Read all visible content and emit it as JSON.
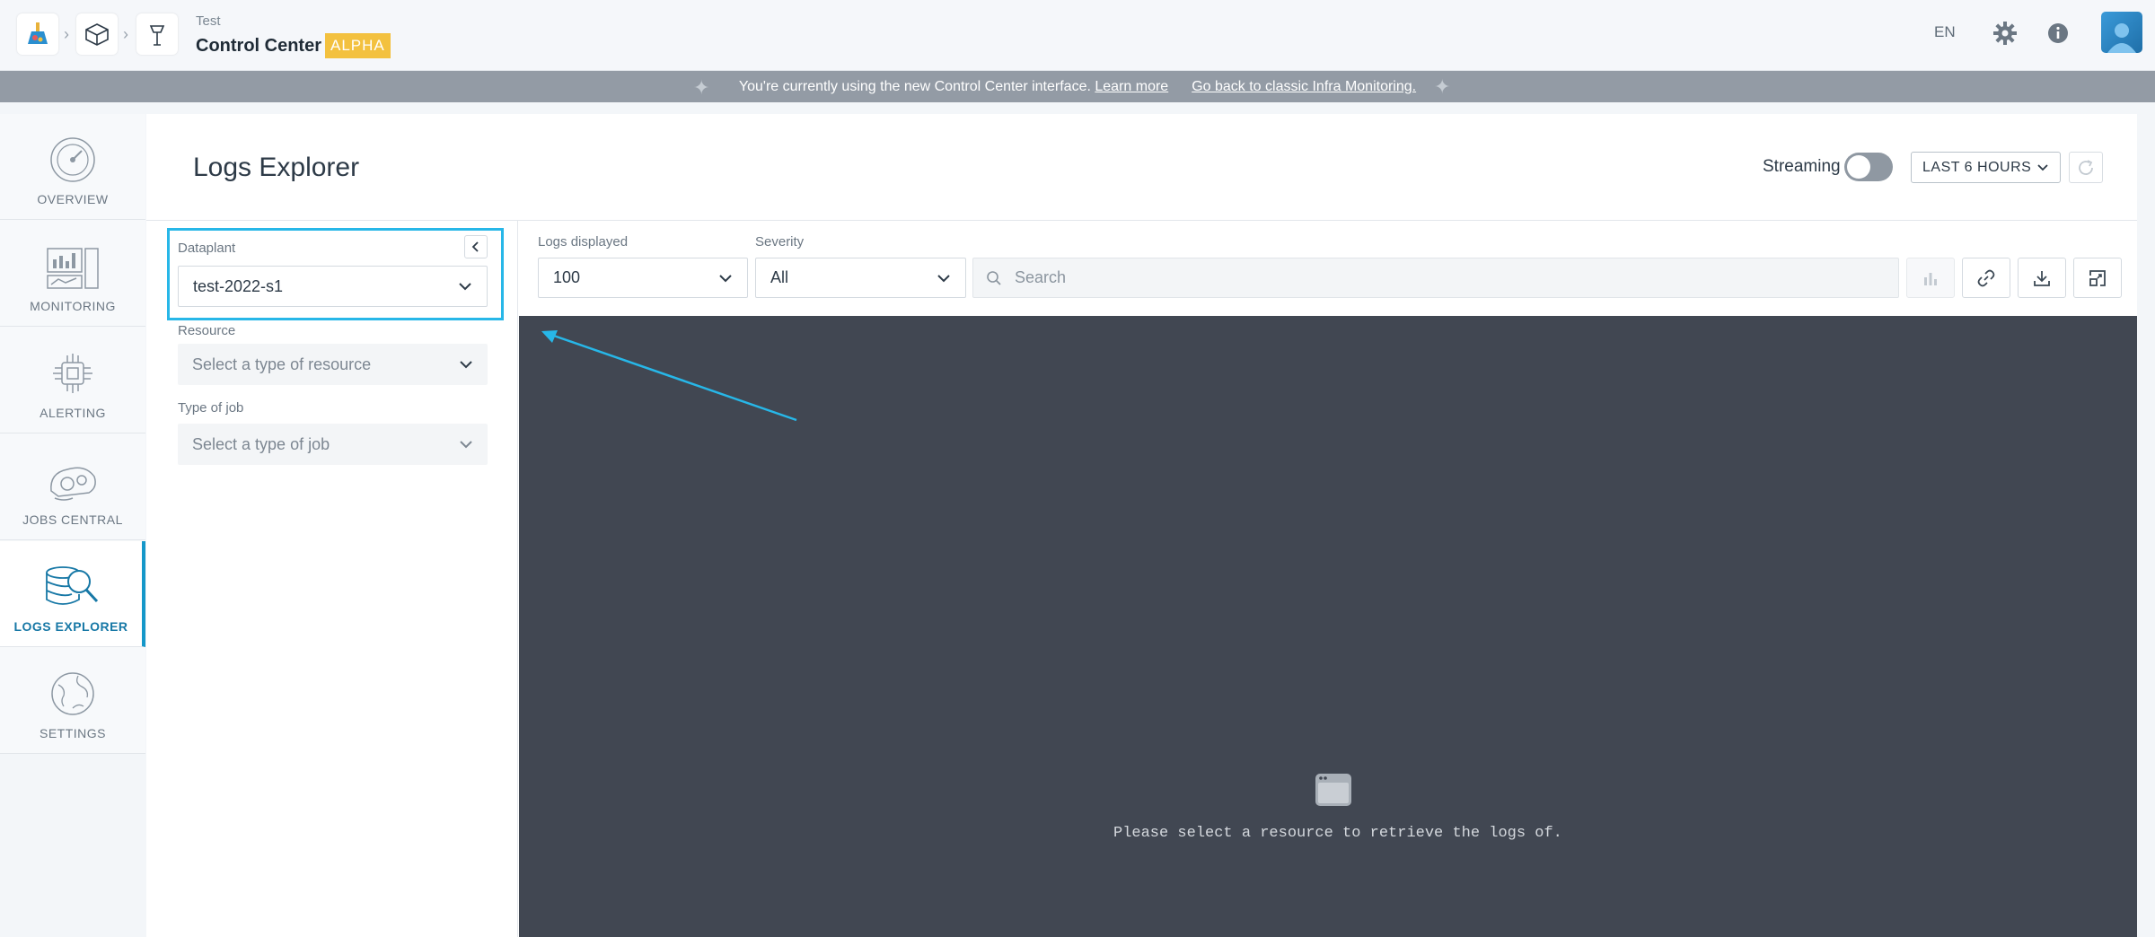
{
  "header": {
    "app_small": "Test",
    "app_title": "Control Center",
    "badge": "ALPHA",
    "language": "EN",
    "icons": [
      "logo-icon",
      "cube-icon",
      "lamp-icon",
      "gear-icon",
      "info-icon",
      "avatar"
    ]
  },
  "banner": {
    "text": "You're currently using the new Control Center interface.",
    "learn_more": "Learn more",
    "back_link": "Go back to classic Infra Monitoring."
  },
  "nav": {
    "items": [
      {
        "label": "OVERVIEW",
        "icon": "dashboard-gauge-icon"
      },
      {
        "label": "MONITORING",
        "icon": "monitoring-charts-icon"
      },
      {
        "label": "ALERTING",
        "icon": "alerting-chip-icon"
      },
      {
        "label": "JOBS CENTRAL",
        "icon": "jobs-brain-icon"
      },
      {
        "label": "LOGS EXPLORER",
        "icon": "logs-database-search-icon"
      },
      {
        "label": "SETTINGS",
        "icon": "settings-globe-icon"
      }
    ],
    "active": "LOGS EXPLORER"
  },
  "page": {
    "title": "Logs Explorer",
    "streaming_label": "Streaming",
    "streaming_on": false,
    "time_range": "LAST 6 HOURS"
  },
  "filters": {
    "dataplant_label": "Dataplant",
    "dataplant_value": "test-2022-s1",
    "resource_label": "Resource",
    "resource_placeholder": "Select a type of resource",
    "job_label": "Type of job",
    "job_placeholder": "Select a type of job"
  },
  "toolbar": {
    "logs_displayed_label": "Logs displayed",
    "logs_displayed_value": "100",
    "severity_label": "Severity",
    "severity_value": "All",
    "search_placeholder": "Search"
  },
  "logs": {
    "empty_message": "Please select a resource to retrieve the logs of."
  },
  "colors": {
    "accent": "#1497c9",
    "highlight": "#27b7e8",
    "badge": "#f3c13f",
    "banner": "#939ba5",
    "logs_bg": "#414752"
  }
}
